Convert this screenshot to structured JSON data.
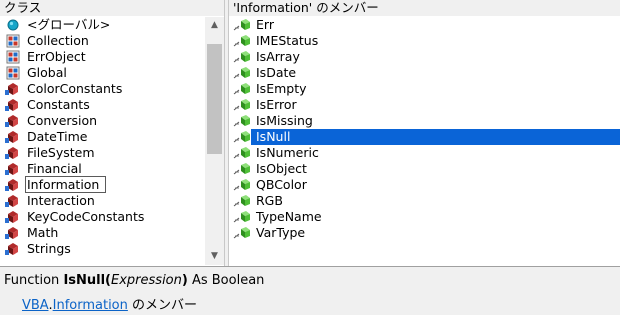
{
  "classes_pane": {
    "header": "クラス",
    "items": [
      {
        "label": "<グローバル>",
        "icon": "globe-icon"
      },
      {
        "label": "Collection",
        "icon": "class-icon"
      },
      {
        "label": "ErrObject",
        "icon": "class-icon"
      },
      {
        "label": "Global",
        "icon": "class-icon"
      },
      {
        "label": "ColorConstants",
        "icon": "module-icon"
      },
      {
        "label": "Constants",
        "icon": "module-icon"
      },
      {
        "label": "Conversion",
        "icon": "module-icon"
      },
      {
        "label": "DateTime",
        "icon": "module-icon"
      },
      {
        "label": "FileSystem",
        "icon": "module-icon"
      },
      {
        "label": "Financial",
        "icon": "module-icon"
      },
      {
        "label": "Information",
        "icon": "module-icon"
      },
      {
        "label": "Interaction",
        "icon": "module-icon"
      },
      {
        "label": "KeyCodeConstants",
        "icon": "module-icon"
      },
      {
        "label": "Math",
        "icon": "module-icon"
      },
      {
        "label": "Strings",
        "icon": "module-icon"
      }
    ],
    "selected": "Information"
  },
  "members_pane": {
    "header": "'Information' のメンバー",
    "items": [
      "Err",
      "IMEStatus",
      "IsArray",
      "IsDate",
      "IsEmpty",
      "IsError",
      "IsMissing",
      "IsNull",
      "IsNumeric",
      "IsObject",
      "QBColor",
      "RGB",
      "TypeName",
      "VarType"
    ],
    "selected": "IsNull"
  },
  "details": {
    "prefix": "Function ",
    "name": "IsNull(",
    "param": "Expression",
    "close": ")",
    "suffix": " As Boolean",
    "library": "VBA",
    "dot": ".",
    "module": "Information",
    "member_of": " のメンバー"
  },
  "colors": {
    "selection": "#0a64d7",
    "link": "#0b63c7",
    "method_icon": "#3fae2a"
  }
}
